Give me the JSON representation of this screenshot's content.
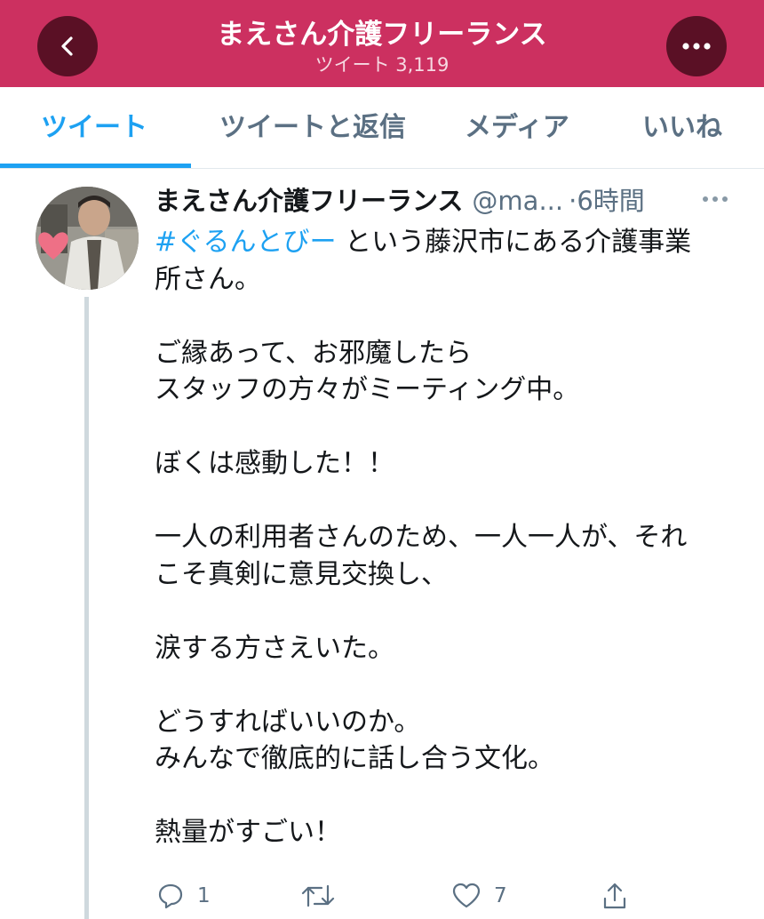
{
  "header": {
    "title": "まえさん介護フリーランス",
    "subtitle": "ツイート 3,119",
    "back_icon": "chevron-left-icon",
    "more_icon": "more-horizontal-icon",
    "color": "#cc3060"
  },
  "tabs": [
    {
      "label": "ツイート",
      "active": true
    },
    {
      "label": "ツイートと返信",
      "active": false
    },
    {
      "label": "メディア",
      "active": false
    },
    {
      "label": "いいね",
      "active": false
    }
  ],
  "tweet": {
    "name": "まえさん介護フリーランス",
    "handle": "@ma...",
    "time": "·6時間",
    "hashtag": "#ぐるんとびー",
    "line1_rest": " という藤沢市にある介護事業",
    "line2": "所さん。",
    "p2_l1": "ご縁あって、お邪魔したら",
    "p2_l2": "スタッフの方々がミーティング中。",
    "p3_l1": "ぼくは感動した！！",
    "p4_l1": "一人の利用者さんのため、一人一人が、それ",
    "p4_l2": "こそ真剣に意見交換し、",
    "p5_l1": "涙する方さえいた。",
    "p6_l1": "どうすればいいのか。",
    "p6_l2": "みんなで徹底的に話し合う文化。",
    "p7_l1": "熱量がすごい！"
  },
  "actions": {
    "reply_count": "1",
    "retweet_count": "",
    "like_count": "7"
  },
  "colors": {
    "accent": "#1da1f2",
    "header_bg": "#cc3060",
    "muted": "#5b7083"
  }
}
